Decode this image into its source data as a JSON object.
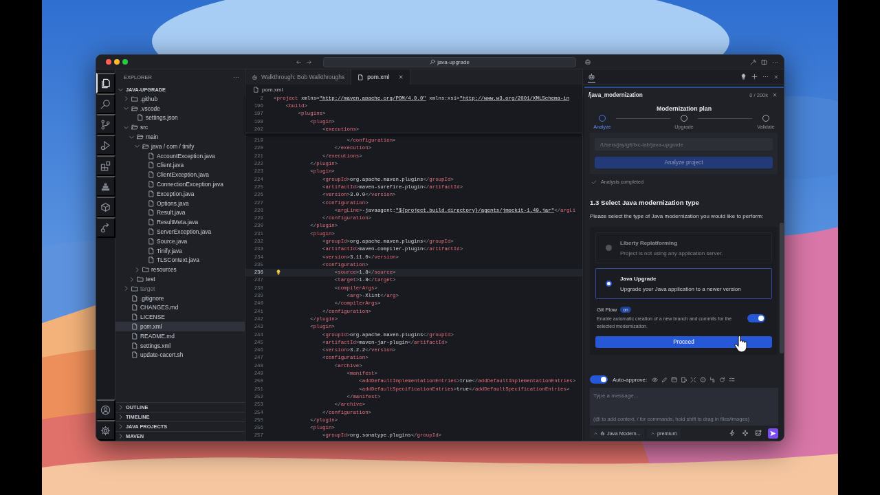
{
  "window": {
    "search": "java-upgrade"
  },
  "activity_bar": {
    "top": [
      {
        "kind": "files",
        "selected": true
      },
      {
        "kind": "search",
        "selected": false
      },
      {
        "kind": "branch",
        "selected": false
      },
      {
        "kind": "run",
        "selected": false
      },
      {
        "kind": "extensions",
        "selected": false
      },
      {
        "kind": "stack",
        "selected": false
      },
      {
        "kind": "package",
        "selected": false
      },
      {
        "kind": "share",
        "selected": false
      }
    ],
    "bottom": [
      {
        "kind": "account"
      },
      {
        "kind": "settings"
      }
    ]
  },
  "explorer": {
    "title": "EXPLORER",
    "root": {
      "label": "JAVA-UPGRADE",
      "expanded": true
    },
    "tree": [
      {
        "label": ".github",
        "kind": "folder",
        "expanded": false,
        "selected": false,
        "dimmed": false
      },
      {
        "label": ".vscode",
        "kind": "folder",
        "expanded": true,
        "selected": false,
        "dimmed": false,
        "children": [
          {
            "label": "settings.json",
            "kind": "file",
            "selected": false,
            "dimmed": false
          }
        ]
      },
      {
        "label": "src",
        "kind": "folder",
        "expanded": true,
        "selected": false,
        "dimmed": false,
        "children": [
          {
            "label": "main",
            "kind": "folder",
            "expanded": true,
            "selected": false,
            "dimmed": false,
            "children": [
              {
                "label": "java / com / tinify",
                "kind": "folder",
                "expanded": true,
                "selected": false,
                "dimmed": false,
                "children": [
                  {
                    "label": "AccountException.java",
                    "kind": "file",
                    "selected": false,
                    "dimmed": false
                  },
                  {
                    "label": "Client.java",
                    "kind": "file",
                    "selected": false,
                    "dimmed": false
                  },
                  {
                    "label": "ClientException.java",
                    "kind": "file",
                    "selected": false,
                    "dimmed": false
                  },
                  {
                    "label": "ConnectionException.java",
                    "kind": "file",
                    "selected": false,
                    "dimmed": false
                  },
                  {
                    "label": "Exception.java",
                    "kind": "file",
                    "selected": false,
                    "dimmed": false
                  },
                  {
                    "label": "Options.java",
                    "kind": "file",
                    "selected": false,
                    "dimmed": false
                  },
                  {
                    "label": "Result.java",
                    "kind": "file",
                    "selected": false,
                    "dimmed": false
                  },
                  {
                    "label": "ResultMeta.java",
                    "kind": "file",
                    "selected": false,
                    "dimmed": false
                  },
                  {
                    "label": "ServerException.java",
                    "kind": "file",
                    "selected": false,
                    "dimmed": false
                  },
                  {
                    "label": "Source.java",
                    "kind": "file",
                    "selected": false,
                    "dimmed": false
                  },
                  {
                    "label": "Tinify.java",
                    "kind": "file",
                    "selected": false,
                    "dimmed": false
                  },
                  {
                    "label": "TLSContext.java",
                    "kind": "file",
                    "selected": false,
                    "dimmed": false
                  }
                ]
              },
              {
                "label": "resources",
                "kind": "folder",
                "expanded": false,
                "selected": false,
                "dimmed": false
              }
            ]
          },
          {
            "label": "test",
            "kind": "folder",
            "expanded": false,
            "selected": false,
            "dimmed": false
          }
        ]
      },
      {
        "label": "target",
        "kind": "folder",
        "expanded": false,
        "selected": false,
        "dimmed": true
      },
      {
        "label": ".gitignore",
        "kind": "file",
        "selected": false,
        "dimmed": false
      },
      {
        "label": "CHANGES.md",
        "kind": "file",
        "selected": false,
        "dimmed": false
      },
      {
        "label": "LICENSE",
        "kind": "file",
        "selected": false,
        "dimmed": false
      },
      {
        "label": "pom.xml",
        "kind": "file",
        "selected": true,
        "dimmed": false
      },
      {
        "label": "README.md",
        "kind": "file",
        "selected": false,
        "dimmed": false
      },
      {
        "label": "settings.xml",
        "kind": "file",
        "selected": false,
        "dimmed": false
      },
      {
        "label": "update-cacert.sh",
        "kind": "file",
        "selected": false,
        "dimmed": false
      }
    ],
    "sections": [
      {
        "label": "OUTLINE",
        "expanded": false
      },
      {
        "label": "TIMELINE",
        "expanded": false
      },
      {
        "label": "JAVA PROJECTS",
        "expanded": false
      },
      {
        "label": "MAVEN",
        "expanded": false
      }
    ]
  },
  "editor": {
    "tabs": [
      {
        "label": "Walkthrough: Bob Walkthroughs",
        "kind": "walkthrough",
        "selected": false
      },
      {
        "label": "pom.xml",
        "kind": "file",
        "selected": true
      }
    ],
    "breadcrumb": "pom.xml",
    "sticky_lines": [
      {
        "number": "2",
        "text": "<project xmlns=\"http://maven.apache.org/POM/4.0.0\" xmlns:xsi=\"http://www.w3.org/2001/XMLSchema-in"
      },
      {
        "number": "196",
        "text": "    <build>"
      },
      {
        "number": "197",
        "text": "        <plugins>"
      },
      {
        "number": "198",
        "text": "            <plugin>"
      },
      {
        "number": "202",
        "text": "                <executions>"
      }
    ],
    "lines": [
      {
        "number": "219",
        "text": "                        </configuration>",
        "current": false
      },
      {
        "number": "220",
        "text": "                    </execution>",
        "current": false
      },
      {
        "number": "221",
        "text": "                </executions>",
        "current": false
      },
      {
        "number": "222",
        "text": "            </plugin>",
        "current": false
      },
      {
        "number": "223",
        "text": "            <plugin>",
        "current": false
      },
      {
        "number": "224",
        "text": "                <groupId>org.apache.maven.plugins</groupId>",
        "current": false
      },
      {
        "number": "225",
        "text": "                <artifactId>maven-surefire-plugin</artifactId>",
        "current": false
      },
      {
        "number": "226",
        "text": "                <version>3.0.0</version>",
        "current": false
      },
      {
        "number": "227",
        "text": "                <configuration>",
        "current": false
      },
      {
        "number": "228",
        "text": "                    <argLine>-javaagent:\"${project.build.directory}/agents/jmockit-1.49.jar\"</argLi",
        "current": false
      },
      {
        "number": "229",
        "text": "                </configuration>",
        "current": false
      },
      {
        "number": "230",
        "text": "            </plugin>",
        "current": false
      },
      {
        "number": "231",
        "text": "            <plugin>",
        "current": false
      },
      {
        "number": "232",
        "text": "                <groupId>org.apache.maven.plugins</groupId>",
        "current": false
      },
      {
        "number": "233",
        "text": "                <artifactId>maven-compiler-plugin</artifactId>",
        "current": false
      },
      {
        "number": "234",
        "text": "                <version>3.11.0</version>",
        "current": false
      },
      {
        "number": "235",
        "text": "                <configuration>",
        "current": false
      },
      {
        "number": "236",
        "text": "                    <source>1.8</source>",
        "current": true
      },
      {
        "number": "237",
        "text": "                    <target>1.8</target>",
        "current": false
      },
      {
        "number": "238",
        "text": "                    <compilerArgs>",
        "current": false
      },
      {
        "number": "239",
        "text": "                        <arg>-Xlint</arg>",
        "current": false
      },
      {
        "number": "240",
        "text": "                    </compilerArgs>",
        "current": false
      },
      {
        "number": "241",
        "text": "                </configuration>",
        "current": false
      },
      {
        "number": "242",
        "text": "            </plugin>",
        "current": false
      },
      {
        "number": "243",
        "text": "            <plugin>",
        "current": false
      },
      {
        "number": "244",
        "text": "                <groupId>org.apache.maven.plugins</groupId>",
        "current": false
      },
      {
        "number": "245",
        "text": "                <artifactId>maven-jar-plugin</artifactId>",
        "current": false
      },
      {
        "number": "246",
        "text": "                <version>3.2.2</version>",
        "current": false
      },
      {
        "number": "247",
        "text": "                <configuration>",
        "current": false
      },
      {
        "number": "248",
        "text": "                    <archive>",
        "current": false
      },
      {
        "number": "249",
        "text": "                        <manifest>",
        "current": false
      },
      {
        "number": "250",
        "text": "                            <addDefaultImplementationEntries>true</addDefaultImplementationEntries>",
        "current": false
      },
      {
        "number": "251",
        "text": "                            <addDefaultSpecificationEntries>true</addDefaultSpecificationEntries>",
        "current": false
      },
      {
        "number": "252",
        "text": "                        </manifest>",
        "current": false
      },
      {
        "number": "253",
        "text": "                    </archive>",
        "current": false
      },
      {
        "number": "254",
        "text": "                </configuration>",
        "current": false
      },
      {
        "number": "255",
        "text": "            </plugin>",
        "current": false
      },
      {
        "number": "256",
        "text": "            <plugin>",
        "current": false
      },
      {
        "number": "257",
        "text": "                <groupId>org.sonatype.plugins</groupId>",
        "current": false
      }
    ]
  },
  "assistant": {
    "command": "/java_modernization",
    "token_count": "0 / 200k",
    "plan": {
      "title": "Modernization plan",
      "steps": [
        {
          "label": "Analyze",
          "selected": true
        },
        {
          "label": "Upgrade",
          "selected": false
        },
        {
          "label": "Validate",
          "selected": false
        }
      ]
    },
    "project_path": {
      "value": "/Users/jay/git/txc-lab/java-upgrade",
      "disabled": true
    },
    "analyze_button": {
      "label": "Analyze project",
      "disabled": true
    },
    "status": "Analysis completed",
    "section_title": "1.3 Select Java modernization type",
    "prompt": "Please select the type of Java modernization you would like to perform:",
    "options": [
      {
        "title": "Liberty Replatforming",
        "description": "Project is not using any application server.",
        "disabled": true,
        "selected": false
      },
      {
        "title": "Java Upgrade",
        "description": "Upgrade your Java application to a newer version",
        "disabled": false,
        "selected": true
      }
    ],
    "git_flow": {
      "label": "Git Flow",
      "badge": "on",
      "description": "Enable automatic creation of a new branch and commits for the selected modernization.",
      "on": true
    },
    "proceed": "Proceed",
    "auto_approve": {
      "label": "Auto-approve:",
      "on": true
    },
    "message": {
      "placeholder": "Type a message...",
      "hint": "(@ to add context, / for commands, hold shift to drag in files/images)"
    },
    "mode": "Java Modern...",
    "model": "premium"
  }
}
